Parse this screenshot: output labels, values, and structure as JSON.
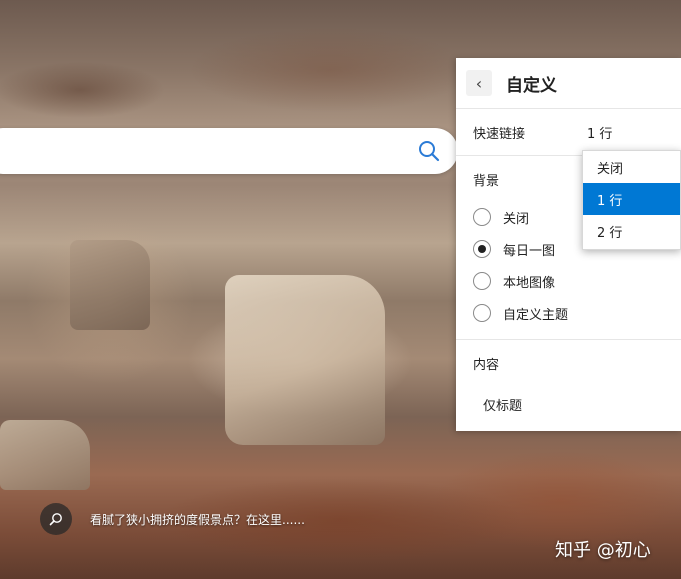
{
  "search": {
    "icon": "search-icon"
  },
  "panel": {
    "title": "自定义",
    "back_icon": "chevron-left-icon",
    "quick_links": {
      "label": "快速链接",
      "value": "1 行"
    },
    "background": {
      "title": "背景",
      "options": [
        {
          "label": "关闭",
          "checked": false
        },
        {
          "label": "每日一图",
          "checked": true
        },
        {
          "label": "本地图像",
          "checked": false
        },
        {
          "label": "自定义主题",
          "checked": false
        }
      ]
    },
    "content": {
      "title": "内容",
      "value": "仅标题"
    }
  },
  "dropdown": {
    "options": [
      {
        "label": "关闭",
        "selected": false
      },
      {
        "label": "1 行",
        "selected": true
      },
      {
        "label": "2 行",
        "selected": false
      }
    ]
  },
  "caption": {
    "icon": "search-icon",
    "text": "看腻了狭小拥挤的度假景点？在这里......"
  },
  "watermark": {
    "text": "知乎 @初心"
  },
  "colors": {
    "accent": "#0078d4",
    "search_icon": "#2b7bd6"
  }
}
